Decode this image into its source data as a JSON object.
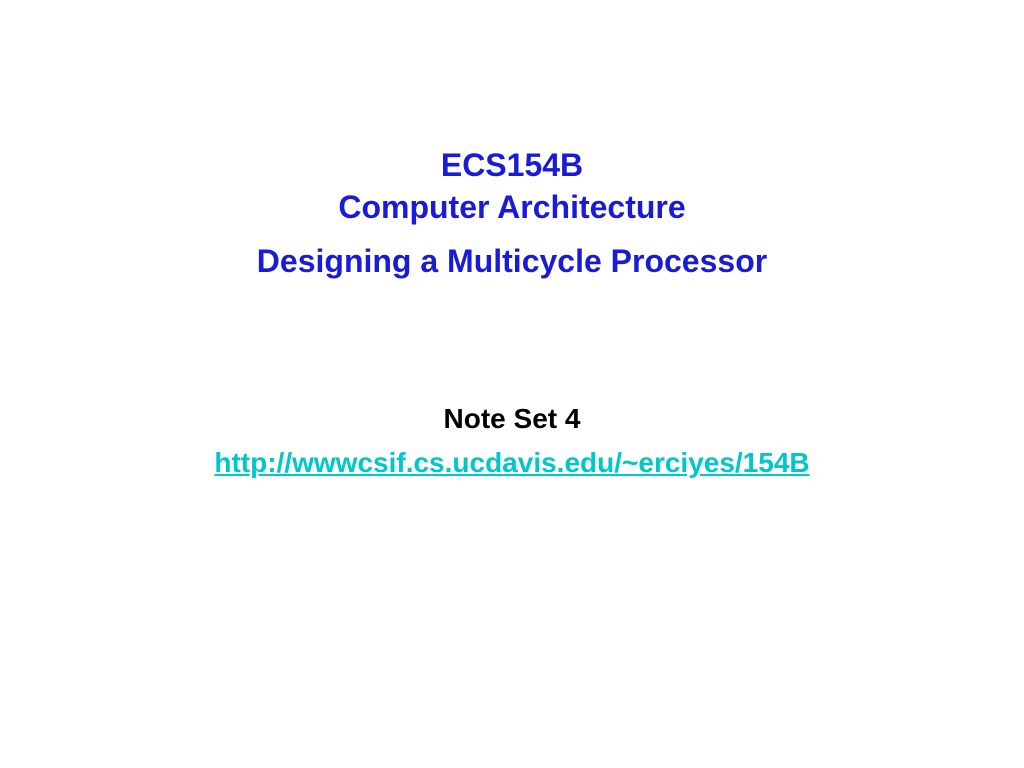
{
  "title": {
    "course_code": "ECS154B",
    "course_name": "Computer Architecture",
    "topic": "Designing a Multicycle Processor"
  },
  "note": {
    "label": "Note Set 4",
    "url": "http://wwwcsif.cs.ucdavis.edu/~erciyes/154B"
  }
}
